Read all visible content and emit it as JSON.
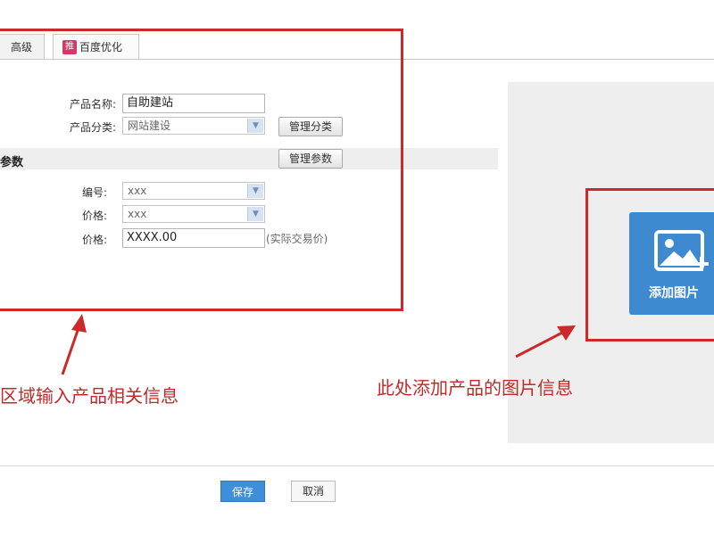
{
  "tabs": {
    "advanced": "高级",
    "baidu_badge": "推",
    "baidu_seo": "百度优化"
  },
  "form": {
    "name_label": "产品名称:",
    "name_value": "自助建站",
    "category_label": "产品分类:",
    "category_value": "网站建设",
    "manage_category": "管理分类",
    "params_title": "参数",
    "manage_params": "管理参数",
    "code_label": "编号:",
    "code_value": "xxx",
    "price_select_label": "价格:",
    "price_select_value": "xxx",
    "price_input_label": "价格:",
    "price_input_value": "XXXX.00",
    "price_hint": "(实际交易价)"
  },
  "annotations": {
    "left_note": "区域输入产品相关信息",
    "right_note": "此处添加产品的图片信息",
    "accent_color": "#cc2a2a"
  },
  "image_panel": {
    "add_image_label": "添加图片",
    "icon": "image-add-icon"
  },
  "footer": {
    "save": "保存",
    "cancel": "取消"
  }
}
